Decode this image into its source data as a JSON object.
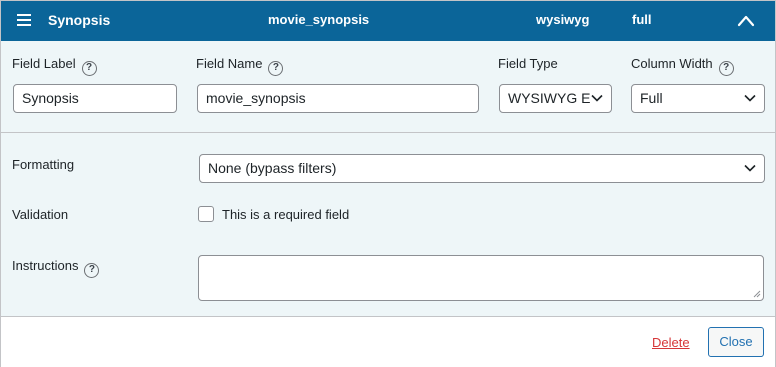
{
  "header": {
    "title": "Synopsis",
    "name": "movie_synopsis",
    "type": "wysiwyg",
    "width": "full"
  },
  "fields": {
    "label": {
      "label": "Field Label",
      "value": "Synopsis"
    },
    "name": {
      "label": "Field Name",
      "value": "movie_synopsis"
    },
    "type": {
      "label": "Field Type",
      "value": "WYSIWYG E"
    },
    "width": {
      "label": "Column Width",
      "value": "Full"
    }
  },
  "formatting": {
    "label": "Formatting",
    "value": "None (bypass filters)"
  },
  "validation": {
    "label": "Validation",
    "checkbox_label": "This is a required field",
    "checked": false
  },
  "instructions": {
    "label": "Instructions",
    "value": ""
  },
  "help_glyph": "?",
  "footer": {
    "delete": "Delete",
    "close": "Close"
  },
  "colors": {
    "header_bg": "#0b6599",
    "panel_bg": "#eef6f8",
    "delete": "#d63638",
    "accent": "#2271b1"
  },
  "icons": {
    "menu": "hamburger-menu-icon",
    "toggle": "chevron-up-icon",
    "help": "help-circle-icon",
    "select": "chevron-down-icon",
    "resize": "resize-grip-icon"
  }
}
